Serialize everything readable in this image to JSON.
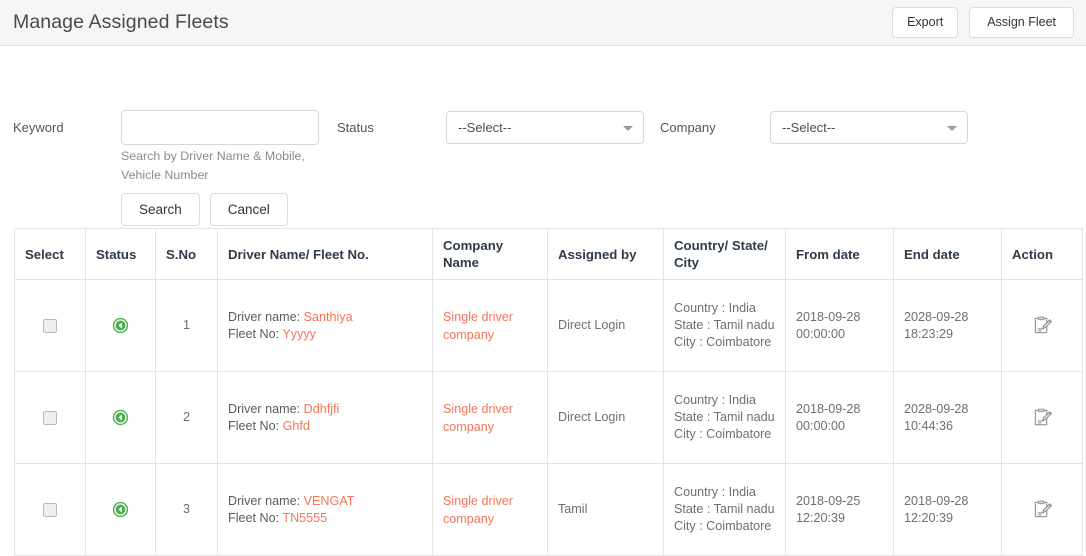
{
  "header": {
    "title": "Manage Assigned Fleets",
    "export_label": "Export",
    "assign_label": "Assign Fleet"
  },
  "filters": {
    "keyword_label": "Keyword",
    "keyword_value": "",
    "keyword_placeholder": "",
    "keyword_hint": "Search by Driver Name & Mobile, Vehicle Number",
    "status_label": "Status",
    "status_value": "--Select--",
    "company_label": "Company",
    "company_value": "--Select--",
    "search_label": "Search",
    "cancel_label": "Cancel"
  },
  "table": {
    "columns": [
      "Select",
      "Status",
      "S.No",
      "Driver Name/ Fleet No.",
      "Company Name",
      "Assigned by",
      "Country/ State/ City",
      "From date",
      "End date",
      "Action"
    ],
    "driver_label": "Driver name:",
    "fleet_label": "Fleet No:",
    "country_label": "Country :",
    "state_label": "State :",
    "city_label": "City :",
    "rows": [
      {
        "sno": "1",
        "status_icon": "green-back-arrow-icon",
        "driver_name": "Santhiya",
        "fleet_no": "Yyyyy",
        "company_name": "Single driver company",
        "assigned_by": "Direct Login",
        "country": "India",
        "state": "Tamil nadu",
        "city": "Coimbatore",
        "from_date": "2018-09-28 00:00:00",
        "end_date": "2028-09-28 18:23:29",
        "action_icon": "edit-icon"
      },
      {
        "sno": "2",
        "status_icon": "green-back-arrow-icon",
        "driver_name": "Ddhfjfi",
        "fleet_no": "Ghfd",
        "company_name": "Single driver company",
        "assigned_by": "Direct Login",
        "country": "India",
        "state": "Tamil nadu",
        "city": "Coimbatore",
        "from_date": "2018-09-28 00:00:00",
        "end_date": "2028-09-28 10:44:36",
        "action_icon": "edit-icon"
      },
      {
        "sno": "3",
        "status_icon": "green-back-arrow-icon",
        "driver_name": "VENGAT",
        "fleet_no": "TN5555",
        "company_name": "Single driver company",
        "assigned_by": "Tamil",
        "country": "India",
        "state": "Tamil nadu",
        "city": "Coimbatore",
        "from_date": "2018-09-25 12:20:39",
        "end_date": "2018-09-28 12:20:39",
        "action_icon": "edit-icon"
      }
    ]
  },
  "colors": {
    "accent": "#f4755a",
    "status_green": "#4caf50",
    "header_bg": "#f6f6f6",
    "border": "#e4e4e4"
  }
}
